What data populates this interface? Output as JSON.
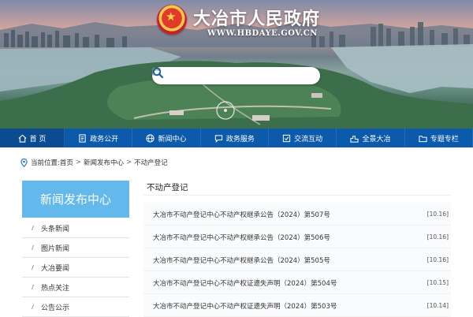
{
  "header": {
    "site_title": "大冶市人民政府",
    "site_url": "WWW.HBDAYE.GOV.CN",
    "search": {
      "placeholder": ""
    }
  },
  "nav": {
    "items": [
      {
        "label": "首 页",
        "icon": "home-icon",
        "active": true
      },
      {
        "label": "政务公开",
        "icon": "document-icon"
      },
      {
        "label": "新闻中心",
        "icon": "globe-icon"
      },
      {
        "label": "政务服务",
        "icon": "chat-icon"
      },
      {
        "label": "交流互动",
        "icon": "interaction-icon"
      },
      {
        "label": "全景大冶",
        "icon": "city-icon"
      },
      {
        "label": "专题专栏",
        "icon": "folder-icon"
      }
    ]
  },
  "breadcrumb": {
    "prefix": "当前位置:",
    "items": [
      "首页",
      "新闻发布中心",
      "不动产登记"
    ],
    "separator": ">"
  },
  "sidebar": {
    "title": "新闻发布中心",
    "items": [
      {
        "label": "头条新闻"
      },
      {
        "label": "图片新闻"
      },
      {
        "label": "大冶要闻"
      },
      {
        "label": "热点关注"
      },
      {
        "label": "公告公示"
      }
    ]
  },
  "main": {
    "title": "不动产登记",
    "news": [
      {
        "title": "大冶市不动产登记中心不动产权继承公告（2024）第507号",
        "date": "[10.16]"
      },
      {
        "title": "大冶市不动产登记中心不动产权继承公告（2024）第506号",
        "date": "[10.16]"
      },
      {
        "title": "大冶市不动产登记中心不动产权继承公告（2024）第505号",
        "date": "[10.16]"
      },
      {
        "title": "大冶市不动产登记中心不动产权证遗失声明（2024）第504号",
        "date": "[10.15]"
      },
      {
        "title": "大冶市不动产登记中心不动产权证遗失声明（2024）第503号",
        "date": "[10.14]"
      }
    ]
  },
  "colors": {
    "nav_background": "#0b5aab",
    "sidebar_header": "#63b8ec"
  }
}
